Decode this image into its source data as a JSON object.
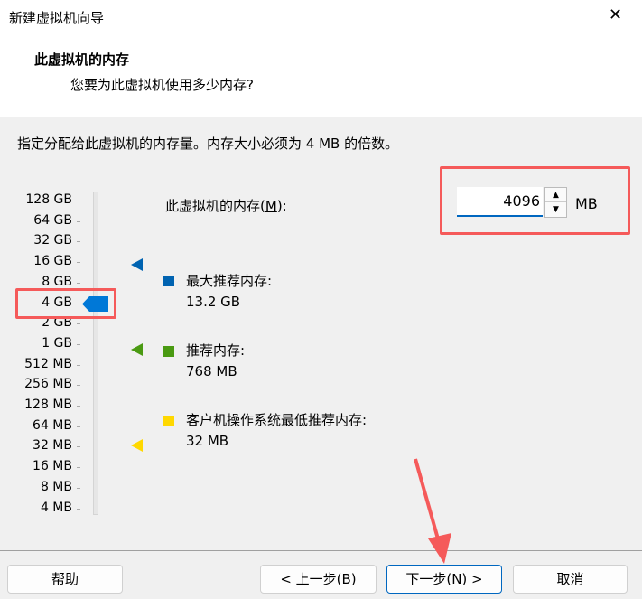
{
  "window": {
    "title": "新建虚拟机向导",
    "close": "✕"
  },
  "header": {
    "title": "此虚拟机的内存",
    "subtitle": "您要为此虚拟机使用多少内存?"
  },
  "instruction": "指定分配给此虚拟机的内存量。内存大小必须为 4 MB 的倍数。",
  "scale": [
    "128 GB",
    "64 GB",
    "32 GB",
    "16 GB",
    "8 GB",
    "4 GB",
    "2 GB",
    "1 GB",
    "512 MB",
    "256 MB",
    "128 MB",
    "64 MB",
    "32 MB",
    "16 MB",
    "8 MB",
    "4 MB"
  ],
  "slider": {
    "selected": "4 GB"
  },
  "memory": {
    "label": "此虚拟机的内存(",
    "mnemonic": "M",
    "label_end": "):",
    "value": "4096",
    "unit": "MB"
  },
  "legend": [
    {
      "label": "最大推荐内存:",
      "value": "13.2 GB",
      "color": "#0063b1"
    },
    {
      "label": "推荐内存:",
      "value": "768 MB",
      "color": "#4a9a12"
    },
    {
      "label": "客户机操作系统最低推荐内存:",
      "value": "32 MB",
      "color": "#ffd800"
    }
  ],
  "buttons": {
    "help": "帮助",
    "back": "< 上一步(B)",
    "next": "下一步(N) >",
    "cancel": "取消"
  }
}
